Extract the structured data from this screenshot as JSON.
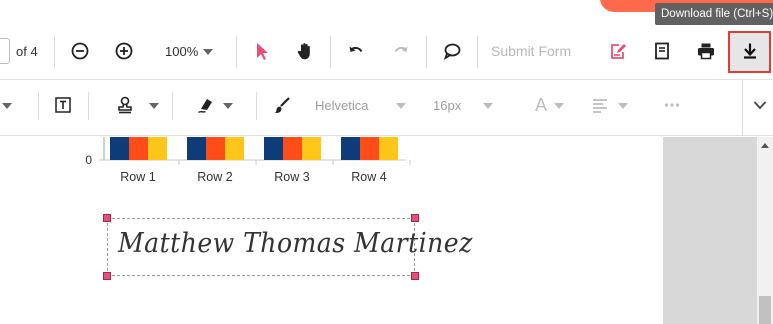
{
  "tooltip": {
    "text": "Download file (Ctrl+S)"
  },
  "pagination": {
    "current_page": "",
    "of_label": "of 4"
  },
  "zoom": {
    "value": "100%"
  },
  "toolbar": {
    "submit_form_label": "Submit Form",
    "icons": [
      "zoom-out-icon",
      "zoom-in-icon",
      "pointer-icon",
      "pan-hand-icon",
      "undo-icon",
      "redo-icon",
      "comment-icon",
      "form-design-icon",
      "text-box-icon",
      "print-icon",
      "download-icon"
    ]
  },
  "format_bar": {
    "font_family": "Helvetica",
    "font_size": "16px",
    "text_color_glyph": "A",
    "icons": [
      "free-text-icon",
      "stamp-icon",
      "signature-pen-icon",
      "ink-brush-icon",
      "align-left-icon",
      "more-icon",
      "chevron-down-icon"
    ]
  },
  "chart_data": {
    "type": "bar",
    "categories": [
      "Row 1",
      "Row 2",
      "Row 3",
      "Row 4"
    ],
    "y_tick_labels": [
      "0"
    ],
    "colors": [
      "#0d3c78",
      "#ff4d1a",
      "#ffc61a"
    ]
  },
  "signature": {
    "text": "Matthew Thomas Martinez"
  },
  "colors": {
    "accent": "#e94e77",
    "highlight_border": "#e53935",
    "brand_orange": "#ff6a4d"
  }
}
